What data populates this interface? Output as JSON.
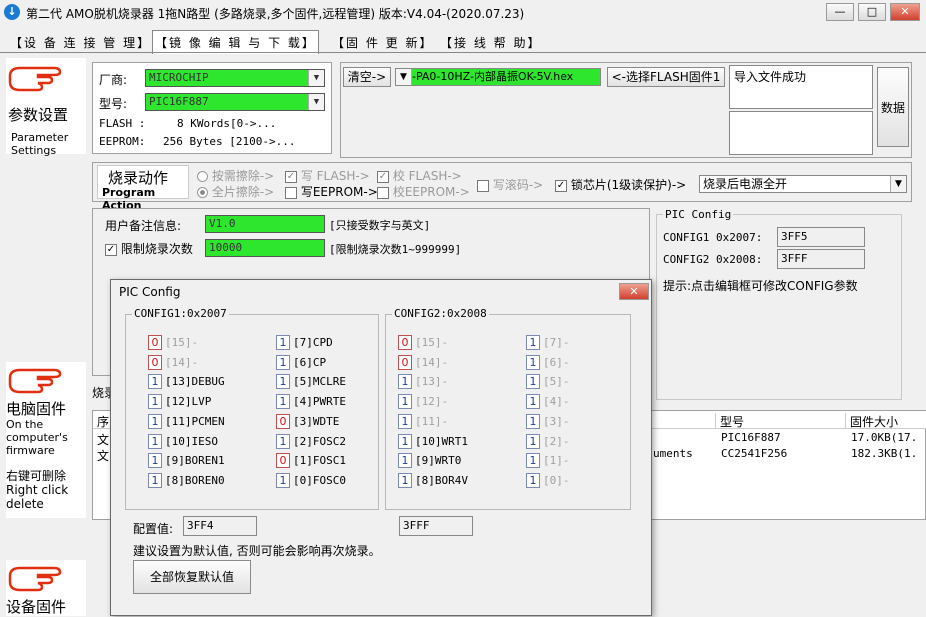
{
  "window": {
    "title": "第二代 AMO脱机烧录器 1拖N路型 (多路烧录,多个固件,远程管理)  版本:V4.04-(2020.07.23)",
    "min": "—",
    "max": "□",
    "close": "✕"
  },
  "menu": [
    "【设 备 连 接 管 理】",
    "【镜 像 编 辑 与 下 载】",
    "【固 件 更 新】",
    "【接 线 帮 助】"
  ],
  "nav": {
    "param": {
      "cn": "参数设置",
      "en1": "Parameter",
      "en2": "Settings"
    },
    "pcfw": {
      "cn": "电脑固件",
      "en1": "On the",
      "en2": "computer's",
      "en3": "firmware",
      "cn2": "右键可删除",
      "en4": "Right click",
      "en5": "delete"
    },
    "devfw": {
      "cn": "设备固件"
    }
  },
  "device": {
    "vendor_label": "厂商:",
    "vendor": "MICROCHIP",
    "model_label": "型号:",
    "model": "PIC16F887",
    "flash_label": "FLASH :",
    "flash": "8 KWords[0->...",
    "eeprom_label": "EEPROM:",
    "eeprom": "256 Bytes [2100->..."
  },
  "firmware": {
    "clear_btn": "清空->",
    "file": "-PA0-10HZ-内部晶振OK-5V.hex",
    "select_btn": "<-选择FLASH固件1",
    "status": "导入文件成功",
    "data_btn": "数据"
  },
  "action": {
    "cn": "烧录动作",
    "en": "Program Action",
    "erase_on_demand": "按需擦除->",
    "erase_all": "全片擦除->",
    "write_flash": "写 FLASH->",
    "verify_flash": "校 FLASH->",
    "write_eeprom": "写EEPROM->",
    "verify_eeprom": "校EEPROM->",
    "write_serial": "写滚码->",
    "lock": "锁芯片(1级读保护)->",
    "after": "烧录后电源全开"
  },
  "notes": {
    "remark_label": "用户备注信息:",
    "remark": "V1.0",
    "remark_hint": "[只接受数字与英文]",
    "limit_label": "限制烧录次数",
    "limit": "10000",
    "limit_hint": "[限制烧录次数1~999999]"
  },
  "pic_config_side": {
    "title": "PIC Config",
    "config1_label": "CONFIG1 0x2007:",
    "config1": "3FF5",
    "config2_label": "CONFIG2 0x2008:",
    "config2": "3FFF",
    "tip": "提示:点击编辑框可修改CONFIG参数"
  },
  "firmware_list": {
    "partial_label": "烧录",
    "columns": [
      "序",
      "型号",
      "固件大小"
    ],
    "rows": [
      {
        "seq": "文",
        "name": "",
        "model": "PIC16F887",
        "size": "17.0KB(17."
      },
      {
        "seq": "文",
        "name": "uments",
        "model": "CC2541F256",
        "size": "182.3KB(1."
      }
    ]
  },
  "dialog": {
    "title": "PIC Config",
    "close": "✕",
    "config1_title": "CONFIG1:0x2007",
    "config2_title": "CONFIG2:0x2008",
    "config1_left": [
      {
        "v": "0",
        "label": "[15]-",
        "disabled": true
      },
      {
        "v": "0",
        "label": "[14]-",
        "disabled": true
      },
      {
        "v": "1",
        "label": "[13]DEBUG",
        "disabled": false
      },
      {
        "v": "1",
        "label": "[12]LVP",
        "disabled": false
      },
      {
        "v": "1",
        "label": "[11]PCMEN",
        "disabled": false
      },
      {
        "v": "1",
        "label": "[10]IESO",
        "disabled": false
      },
      {
        "v": "1",
        "label": "[9]BOREN1",
        "disabled": false
      },
      {
        "v": "1",
        "label": "[8]BOREN0",
        "disabled": false
      }
    ],
    "config1_right": [
      {
        "v": "1",
        "label": "[7]CPD",
        "disabled": false
      },
      {
        "v": "1",
        "label": "[6]CP",
        "disabled": false
      },
      {
        "v": "1",
        "label": "[5]MCLRE",
        "disabled": false
      },
      {
        "v": "1",
        "label": "[4]PWRTE",
        "disabled": false
      },
      {
        "v": "0",
        "label": "[3]WDTE",
        "disabled": false
      },
      {
        "v": "1",
        "label": "[2]FOSC2",
        "disabled": false
      },
      {
        "v": "0",
        "label": "[1]FOSC1",
        "disabled": false
      },
      {
        "v": "1",
        "label": "[0]FOSC0",
        "disabled": false
      }
    ],
    "config2_left": [
      {
        "v": "0",
        "label": "[15]-",
        "disabled": true
      },
      {
        "v": "0",
        "label": "[14]-",
        "disabled": true
      },
      {
        "v": "1",
        "label": "[13]-",
        "disabled": true
      },
      {
        "v": "1",
        "label": "[12]-",
        "disabled": true
      },
      {
        "v": "1",
        "label": "[11]-",
        "disabled": true
      },
      {
        "v": "1",
        "label": "[10]WRT1",
        "disabled": false
      },
      {
        "v": "1",
        "label": "[9]WRT0",
        "disabled": false
      },
      {
        "v": "1",
        "label": "[8]BOR4V",
        "disabled": false
      }
    ],
    "config2_right": [
      {
        "v": "1",
        "label": "[7]-",
        "disabled": true
      },
      {
        "v": "1",
        "label": "[6]-",
        "disabled": true
      },
      {
        "v": "1",
        "label": "[5]-",
        "disabled": true
      },
      {
        "v": "1",
        "label": "[4]-",
        "disabled": true
      },
      {
        "v": "1",
        "label": "[3]-",
        "disabled": true
      },
      {
        "v": "1",
        "label": "[2]-",
        "disabled": true
      },
      {
        "v": "1",
        "label": "[1]-",
        "disabled": true
      },
      {
        "v": "1",
        "label": "[0]-",
        "disabled": true
      }
    ],
    "value_label": "配置值:",
    "config1_value": "3FF4",
    "config2_value": "3FFF",
    "advice": "建议设置为默认值, 否则可能会影响再次烧录。",
    "reset_btn": "全部恢复默认值"
  },
  "colors": {
    "green_field": "#2ee62e",
    "bit_one": "#1f3fa0",
    "bit_zero": "#d01010",
    "accent": "#d04030"
  }
}
